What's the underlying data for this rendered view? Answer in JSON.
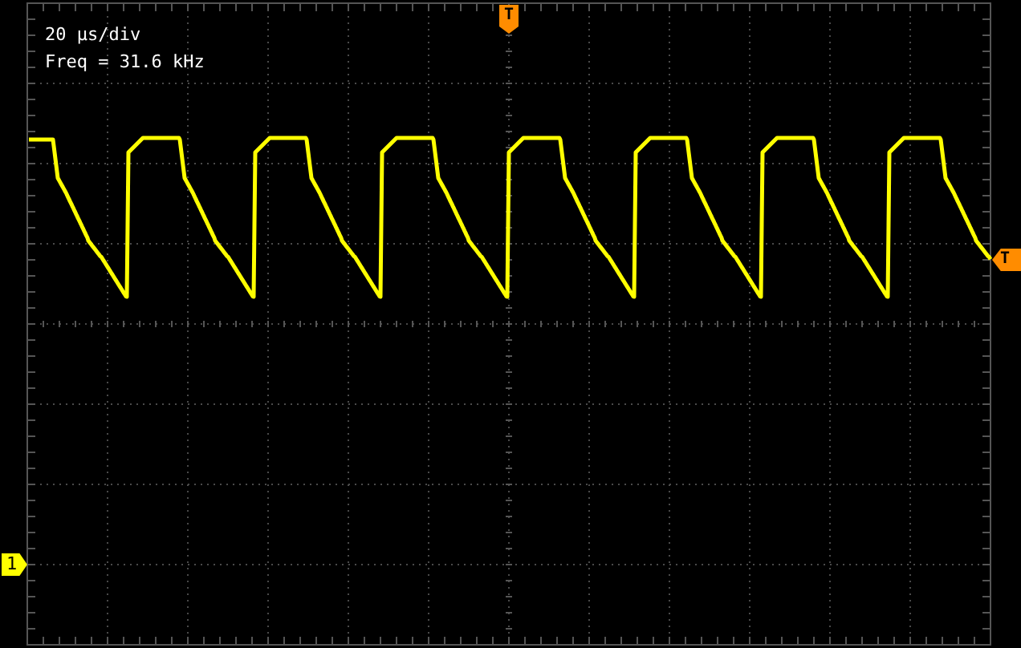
{
  "readout": {
    "timebase": "20 µs/div",
    "frequency": "Freq = 31.6 kHz"
  },
  "markers": {
    "trigger_position": "T",
    "trigger_level": "T",
    "channel": "1"
  }
}
